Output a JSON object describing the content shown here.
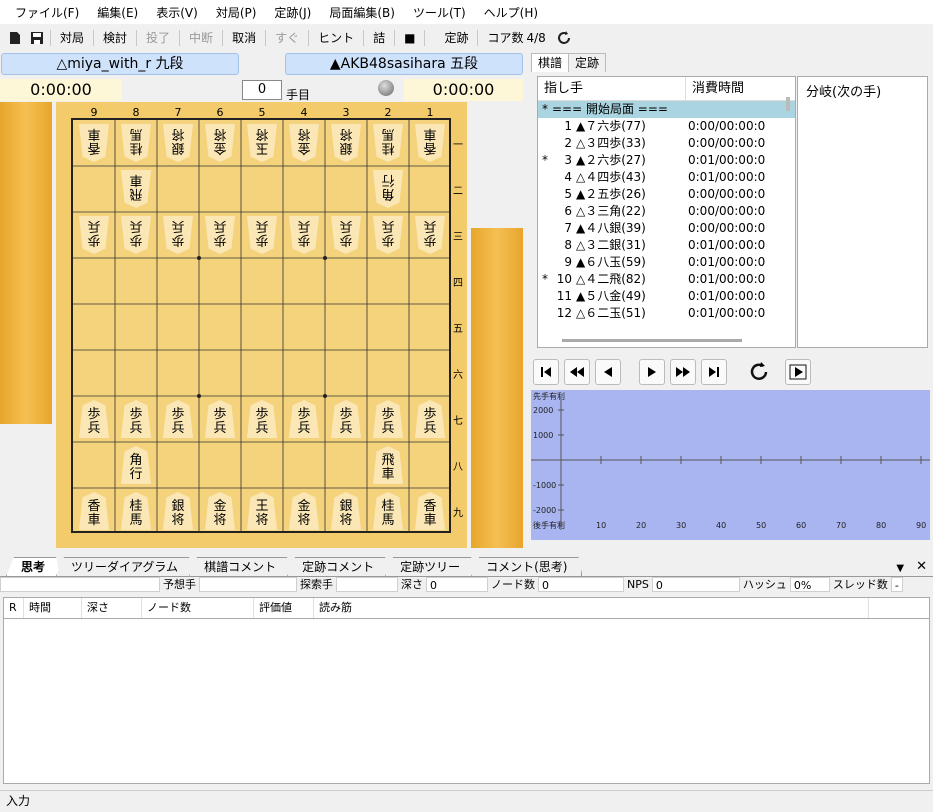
{
  "menu": [
    "ファイル(F)",
    "編集(E)",
    "表示(V)",
    "対局(P)",
    "定跡(J)",
    "局面編集(B)",
    "ツール(T)",
    "ヘルプ(H)"
  ],
  "toolbar": {
    "taikyoku": "対局",
    "kento": "検討",
    "toryo": "投了",
    "chudan": "中断",
    "torikeshi": "取消",
    "sugu": "すぐ",
    "hint": "ヒント",
    "tsume": "詰",
    "stop": "■",
    "joseki": "定跡",
    "core_label": "コア数",
    "core_value": "4/8"
  },
  "players": {
    "gote": "△miya_with_r 九段",
    "sente": "▲AKB48sasihara 五段"
  },
  "clocks": {
    "gote": "0:00:00",
    "sente": "0:00:00"
  },
  "move_number": {
    "value": "0",
    "suffix": "手目"
  },
  "board": {
    "columns": [
      "9",
      "8",
      "7",
      "6",
      "5",
      "4",
      "3",
      "2",
      "1"
    ],
    "rows": [
      "一",
      "二",
      "三",
      "四",
      "五",
      "六",
      "七",
      "八",
      "九"
    ],
    "gote_back": [
      "香車",
      "桂馬",
      "銀将",
      "金将",
      "玉将",
      "金将",
      "銀将",
      "桂馬",
      "香車"
    ],
    "gote_rook": "飛車",
    "gote_bishop": "角行",
    "pawn": "歩兵",
    "sente_back": [
      "香車",
      "桂馬",
      "銀将",
      "金将",
      "王将",
      "金将",
      "銀将",
      "桂馬",
      "香車"
    ],
    "sente_bishop": "角行",
    "sente_rook": "飛車"
  },
  "right_tabs": [
    "棋譜",
    "定跡"
  ],
  "kifu": {
    "headers": {
      "move": "指し手",
      "time": "消費時間"
    },
    "start": {
      "mark": "*",
      "text": "=== 開始局面 ==="
    },
    "moves": [
      {
        "mark": "",
        "n": "1",
        "text": "▲７六歩(77)",
        "time": "0:00/00:00:0"
      },
      {
        "mark": "",
        "n": "2",
        "text": "△３四歩(33)",
        "time": "0:00/00:00:0"
      },
      {
        "mark": "*",
        "n": "3",
        "text": "▲２六歩(27)",
        "time": "0:01/00:00:0"
      },
      {
        "mark": "",
        "n": "4",
        "text": "△４四歩(43)",
        "time": "0:01/00:00:0"
      },
      {
        "mark": "",
        "n": "5",
        "text": "▲２五歩(26)",
        "time": "0:00/00:00:0"
      },
      {
        "mark": "",
        "n": "6",
        "text": "△３三角(22)",
        "time": "0:00/00:00:0"
      },
      {
        "mark": "",
        "n": "7",
        "text": "▲４八銀(39)",
        "time": "0:00/00:00:0"
      },
      {
        "mark": "",
        "n": "8",
        "text": "△３二銀(31)",
        "time": "0:01/00:00:0"
      },
      {
        "mark": "",
        "n": "9",
        "text": "▲６八玉(59)",
        "time": "0:01/00:00:0"
      },
      {
        "mark": "*",
        "n": "10",
        "text": "△４二飛(82)",
        "time": "0:01/00:00:0"
      },
      {
        "mark": "",
        "n": "11",
        "text": "▲５八金(49)",
        "time": "0:01/00:00:0"
      },
      {
        "mark": "",
        "n": "12",
        "text": "△６二玉(51)",
        "time": "0:01/00:00:0"
      }
    ]
  },
  "branch_title": "分岐(次の手)",
  "graph": {
    "top_label": "先手有利",
    "bottom_label": "後手有利",
    "y_ticks": [
      "2000",
      "1000",
      "-1000",
      "-2000"
    ],
    "x_ticks": [
      "10",
      "20",
      "30",
      "40",
      "50",
      "60",
      "70",
      "80",
      "90"
    ]
  },
  "bottom_tabs": [
    "思考",
    "ツリーダイアグラム",
    "棋譜コメント",
    "定跡コメント",
    "定跡ツリー",
    "コメント(思考)"
  ],
  "info": {
    "yoso": "予想手",
    "tansaku": "探索手",
    "fukasa": "深さ",
    "fukasa_val": "0",
    "node": "ノード数",
    "node_val": "0",
    "nps": "NPS",
    "nps_val": "0",
    "hash": "ハッシュ",
    "hash_val": "0%",
    "thread": "スレッド数",
    "thread_val": "-"
  },
  "think_headers": [
    "R",
    "時間",
    "深さ",
    "ノード数",
    "評価値",
    "読み筋"
  ],
  "status": "入力"
}
